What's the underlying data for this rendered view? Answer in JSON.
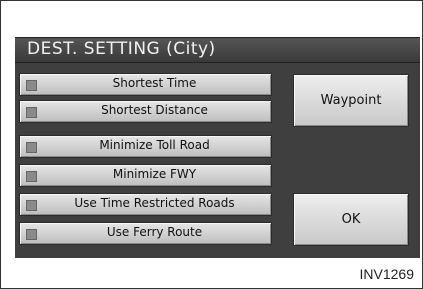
{
  "title": "DEST. SETTING (City)",
  "options": [
    {
      "label": "Shortest Time"
    },
    {
      "label": "Shortest Distance"
    },
    {
      "label": "Minimize Toll Road"
    },
    {
      "label": "Minimize FWY"
    },
    {
      "label": "Use Time Restricted Roads"
    },
    {
      "label": "Use Ferry Route"
    }
  ],
  "buttons": {
    "waypoint": "Waypoint",
    "ok": "OK"
  },
  "figure_code": "INV1269"
}
